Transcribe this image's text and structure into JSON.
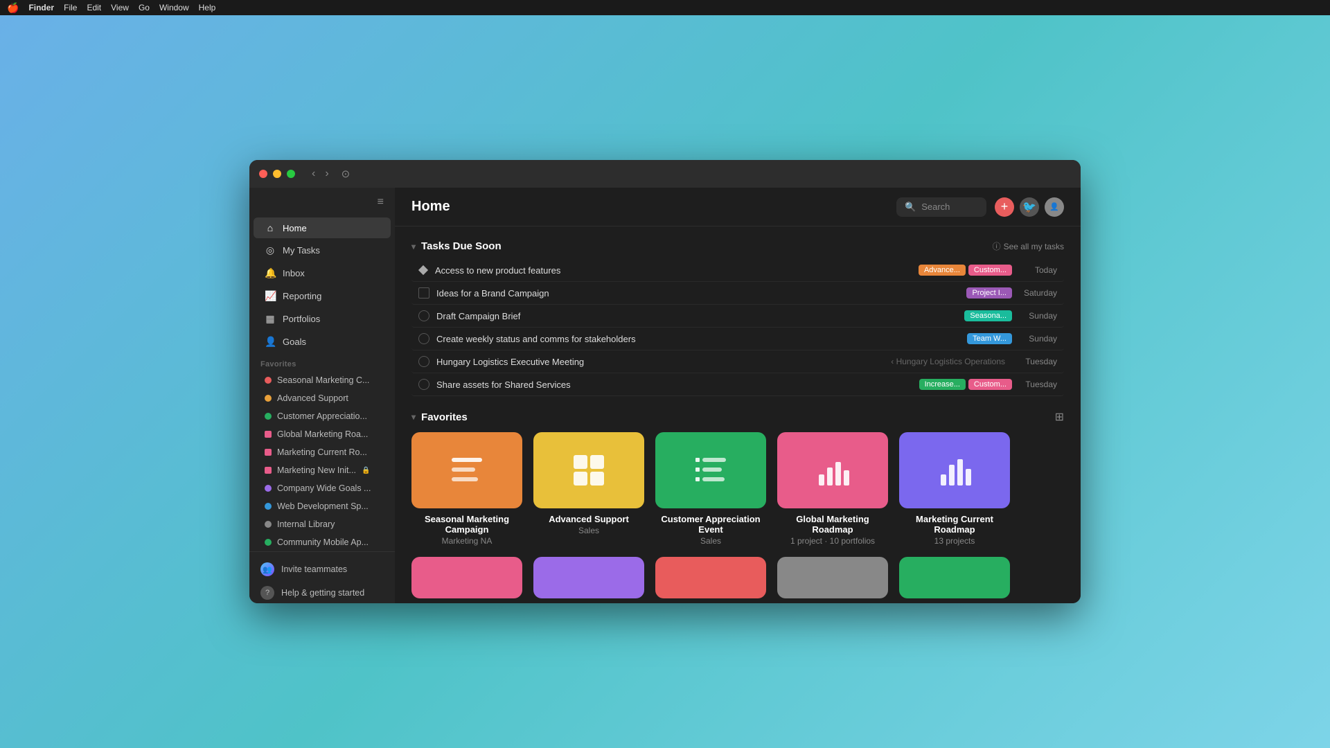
{
  "window": {
    "title": "Home"
  },
  "macos_menu": {
    "apple": "🍎",
    "items": [
      "Finder",
      "File",
      "Edit",
      "View",
      "Go",
      "Window",
      "Help"
    ]
  },
  "sidebar": {
    "nav_items": [
      {
        "id": "home",
        "icon": "⌂",
        "label": "Home",
        "active": true
      },
      {
        "id": "my-tasks",
        "icon": "◎",
        "label": "My Tasks",
        "active": false
      },
      {
        "id": "inbox",
        "icon": "🔔",
        "label": "Inbox",
        "active": false
      },
      {
        "id": "reporting",
        "icon": "📈",
        "label": "Reporting",
        "active": false
      },
      {
        "id": "portfolios",
        "icon": "⬜",
        "label": "Portfolios",
        "active": false
      },
      {
        "id": "goals",
        "icon": "👤",
        "label": "Goals",
        "active": false
      }
    ],
    "section_label": "Favorites",
    "favorites": [
      {
        "id": "seasonal",
        "label": "Seasonal Marketing C...",
        "color": "#e85c5c",
        "type": "dot"
      },
      {
        "id": "advanced",
        "label": "Advanced Support",
        "color": "#e8a03a",
        "type": "dot"
      },
      {
        "id": "customer",
        "label": "Customer Appreciatio...",
        "color": "#27ae60",
        "type": "dot"
      },
      {
        "id": "global",
        "label": "Global Marketing Roa...",
        "color": "#e85c8a",
        "type": "bar"
      },
      {
        "id": "marketing-current",
        "label": "Marketing Current Ro...",
        "color": "#e85c8a",
        "type": "bar"
      },
      {
        "id": "marketing-new",
        "label": "Marketing New Init...",
        "color": "#e85c8a",
        "type": "bar",
        "lock": true
      },
      {
        "id": "company",
        "label": "Company Wide Goals ...",
        "color": "#9b6be8",
        "type": "dot"
      },
      {
        "id": "web",
        "label": "Web Development Sp...",
        "color": "#3498db",
        "type": "dot"
      },
      {
        "id": "internal",
        "label": "Internal Library",
        "color": "#888",
        "type": "dot"
      },
      {
        "id": "community",
        "label": "Community Mobile Ap...",
        "color": "#27ae60",
        "type": "dot"
      }
    ],
    "bottom_items": [
      {
        "id": "invite",
        "label": "Invite teammates",
        "icon": "👥"
      },
      {
        "id": "help",
        "label": "Help & getting started",
        "icon": "❓"
      }
    ]
  },
  "topbar": {
    "title": "Home",
    "search_placeholder": "Search"
  },
  "tasks_section": {
    "title": "Tasks Due Soon",
    "see_all_label": "See all my tasks",
    "tasks": [
      {
        "id": 1,
        "type": "diamond",
        "name": "Access to new product features",
        "sub": "",
        "tags": [
          "Advance...",
          "Custom..."
        ],
        "tag_colors": [
          "orange",
          "pink"
        ],
        "date": "Today"
      },
      {
        "id": 2,
        "type": "box",
        "name": "Ideas for a Brand Campaign",
        "sub": "",
        "tags": [
          "Project I..."
        ],
        "tag_colors": [
          "purple"
        ],
        "date": "Saturday"
      },
      {
        "id": 3,
        "type": "circle",
        "name": "Draft Campaign Brief",
        "sub": "",
        "tags": [
          "Seasona..."
        ],
        "tag_colors": [
          "teal"
        ],
        "date": "Sunday"
      },
      {
        "id": 4,
        "type": "circle",
        "name": "Create weekly status and comms for stakeholders",
        "sub": "",
        "tags": [
          "Team W..."
        ],
        "tag_colors": [
          "blue"
        ],
        "date": "Sunday"
      },
      {
        "id": 5,
        "type": "circle",
        "name": "Hungary Logistics Executive Meeting",
        "sub": "‹ Hungary Logistics Operations",
        "tags": [],
        "tag_colors": [],
        "date": "Tuesday"
      },
      {
        "id": 6,
        "type": "circle",
        "name": "Share assets for Shared Services",
        "sub": "",
        "tags": [
          "Increase...",
          "Custom..."
        ],
        "tag_colors": [
          "green",
          "pink"
        ],
        "date": "Tuesday"
      }
    ]
  },
  "favorites_section": {
    "title": "Favorites",
    "cards": [
      {
        "id": "seasonal",
        "name": "Seasonal Marketing Campaign",
        "sub": "Marketing NA",
        "bg_color": "#e8863a",
        "icon_type": "list"
      },
      {
        "id": "advanced-support",
        "name": "Advanced Support",
        "sub": "Sales",
        "bg_color": "#e8c03a",
        "icon_type": "grid"
      },
      {
        "id": "customer-appreciation",
        "name": "Customer Appreciation Event",
        "sub": "Sales",
        "bg_color": "#27ae60",
        "icon_type": "checklist"
      },
      {
        "id": "global-marketing",
        "name": "Global Marketing Roadmap",
        "sub": "1 project · 10 portfolios",
        "bg_color": "#e85c8a",
        "icon_type": "bar-chart"
      },
      {
        "id": "marketing-current",
        "name": "Marketing Current Roadmap",
        "sub": "13 projects",
        "bg_color": "#7b68ee",
        "icon_type": "bar-chart"
      }
    ],
    "bottom_cards": [
      {
        "id": "bc1",
        "bg_color": "#e85c8a"
      },
      {
        "id": "bc2",
        "bg_color": "#9b6be8"
      },
      {
        "id": "bc3",
        "bg_color": "#e85c5c"
      },
      {
        "id": "bc4",
        "bg_color": "#888"
      },
      {
        "id": "bc5",
        "bg_color": "#27ae60"
      }
    ]
  },
  "icons": {
    "home": "⌂",
    "tasks": "◎",
    "inbox": "🔔",
    "chevron_down": "▾",
    "chevron_right": "›",
    "collapse": "≡",
    "info": "ⓘ",
    "grid": "⊞",
    "add": "+",
    "search": "🔍"
  }
}
